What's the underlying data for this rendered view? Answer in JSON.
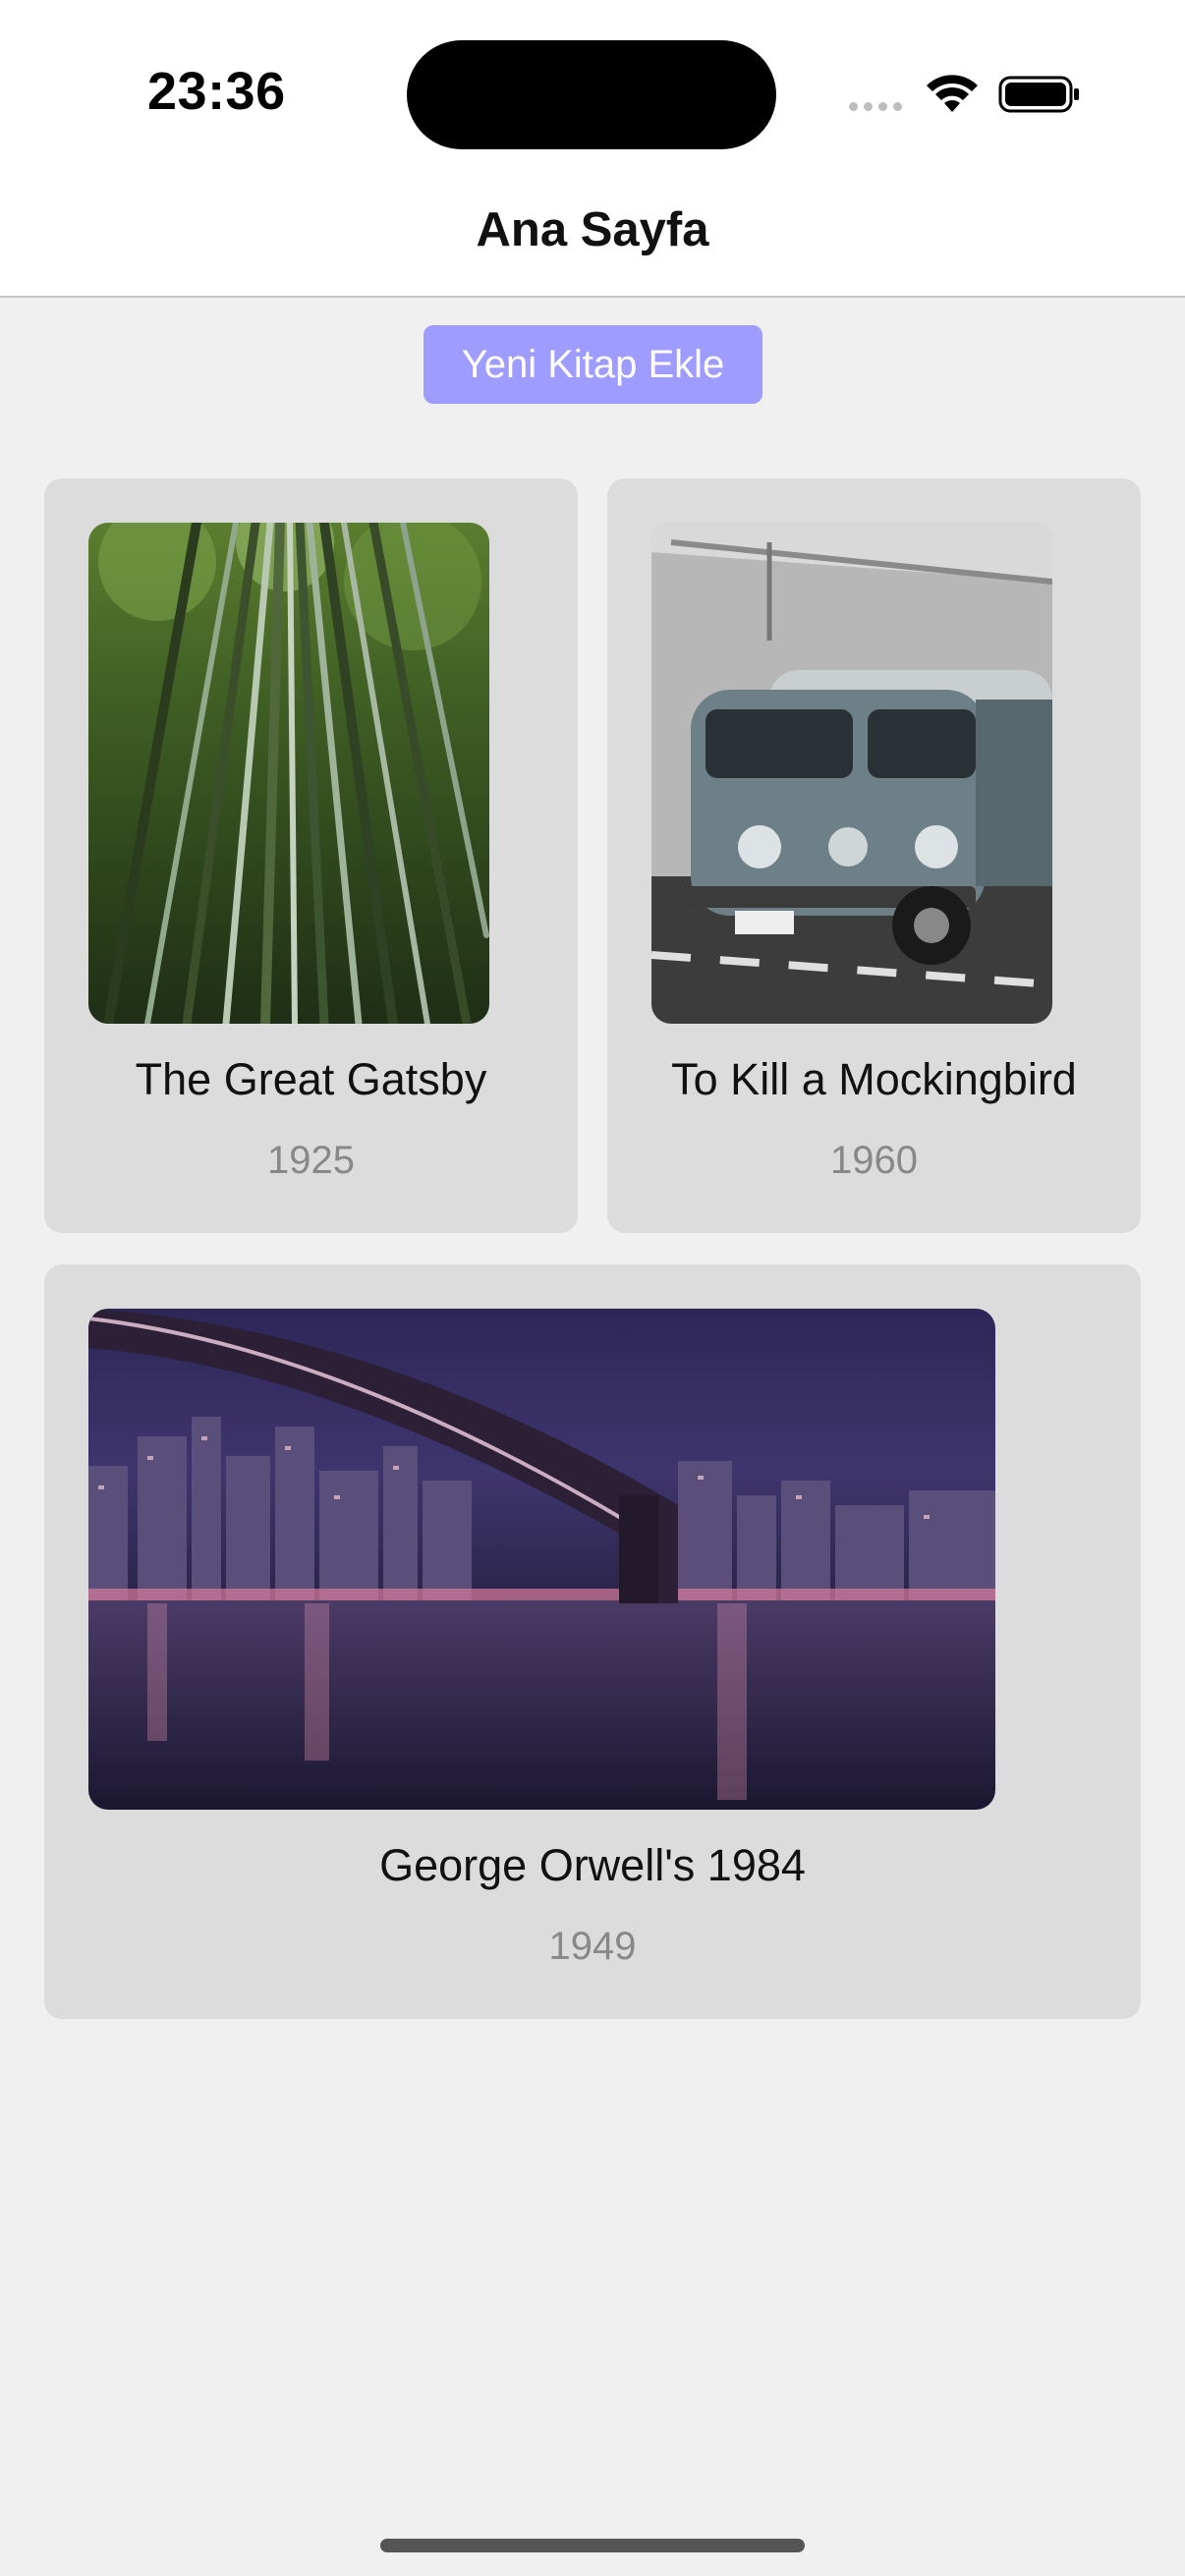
{
  "status_bar": {
    "time": "23:36"
  },
  "nav": {
    "title": "Ana Sayfa"
  },
  "actions": {
    "add_book_label": "Yeni Kitap Ekle"
  },
  "books": [
    {
      "title": "The Great Gatsby",
      "year": "1925",
      "image_icon": "bamboo-forest-image"
    },
    {
      "title": "To Kill a Mockingbird",
      "year": "1960",
      "image_icon": "vw-van-image"
    },
    {
      "title": "George Orwell's 1984",
      "year": "1949",
      "image_icon": "city-bridge-night-image"
    }
  ],
  "colors": {
    "accent_button": "#9f9cff",
    "card_background": "#dcdcdc",
    "page_background": "#f0f0f0"
  }
}
